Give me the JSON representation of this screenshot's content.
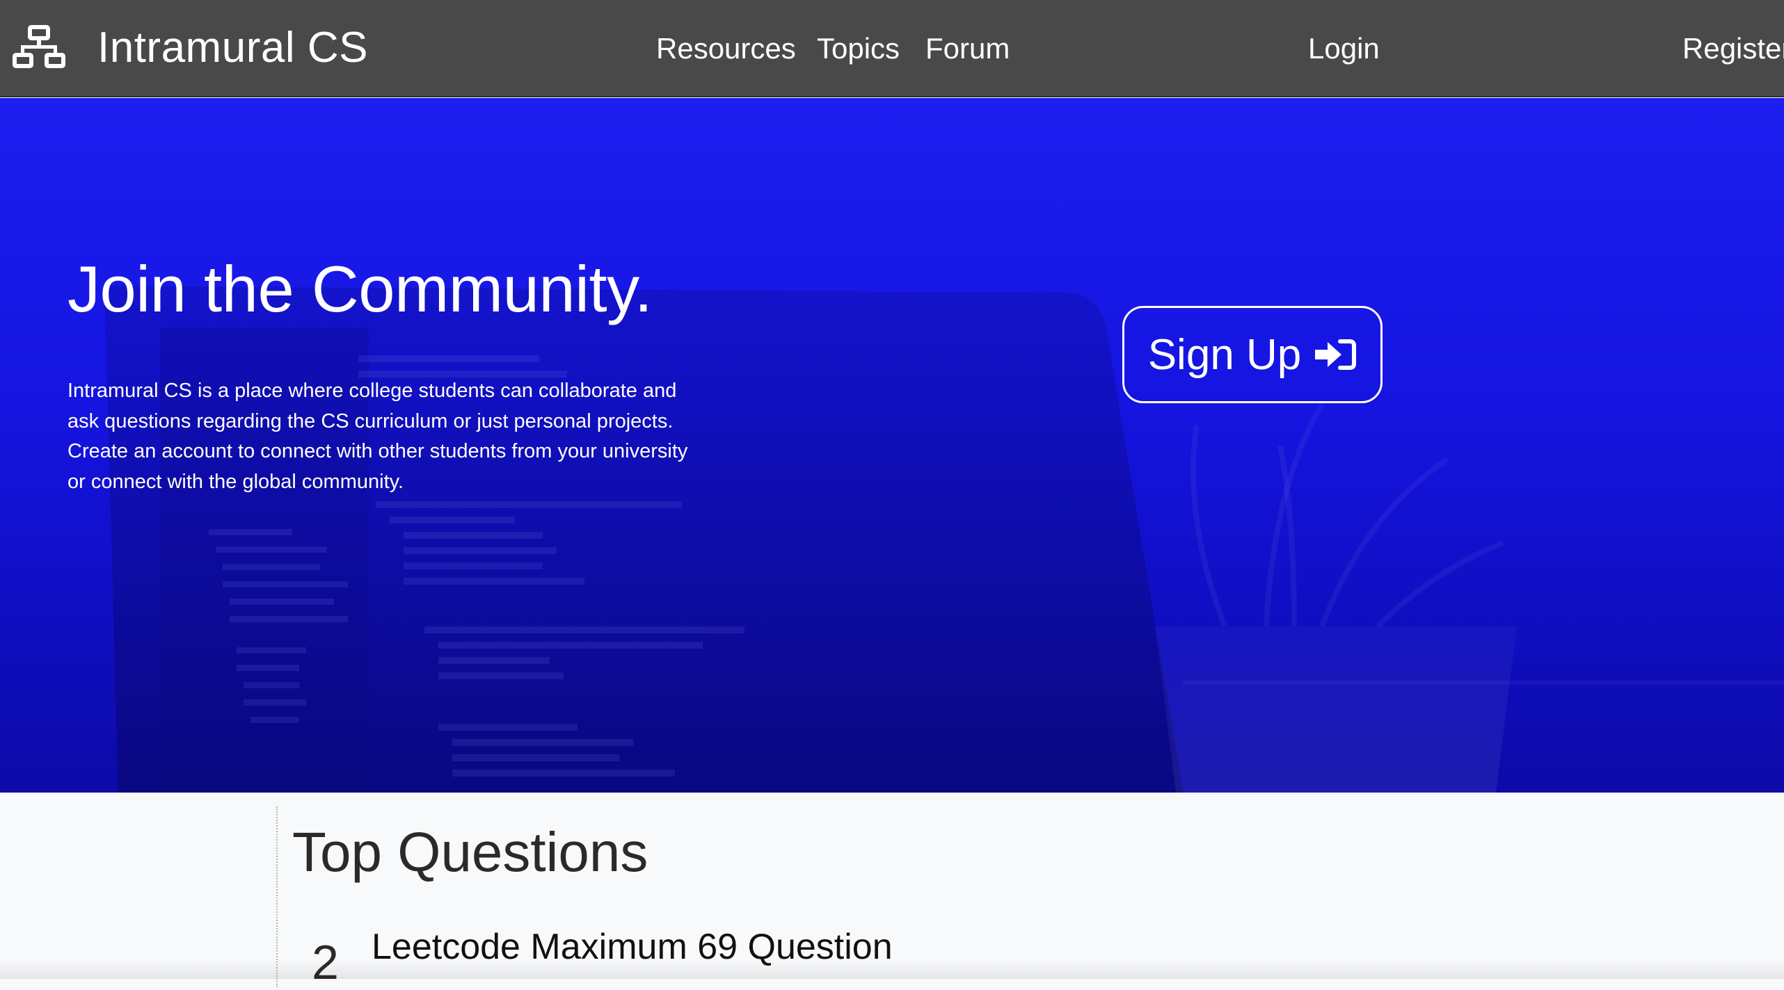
{
  "navbar": {
    "brand_icon": "sitemap-icon",
    "brand_name": "Intramural CS",
    "links": {
      "resources": "Resources",
      "topics": "Topics",
      "forum": "Forum",
      "login": "Login",
      "register": "Register"
    }
  },
  "hero": {
    "title": "Join the Community.",
    "description": "Intramural CS is a place where college students can collaborate and ask questions regarding the CS curriculum or just personal projects. Create an account to connect with other students from your university or connect with the global community.",
    "signup_label": "Sign Up",
    "signup_icon": "sign-in-icon"
  },
  "questions": {
    "section_title": "Top Questions",
    "items": [
      {
        "votes": "2",
        "title": "Leetcode Maximum 69 Question"
      }
    ]
  },
  "colors": {
    "navbar_bg": "#494949",
    "hero_top": "#1c1ff0",
    "hero_bottom": "#0c0aa8",
    "page_bg": "#f8f9fb",
    "text_light": "#ffffff"
  }
}
